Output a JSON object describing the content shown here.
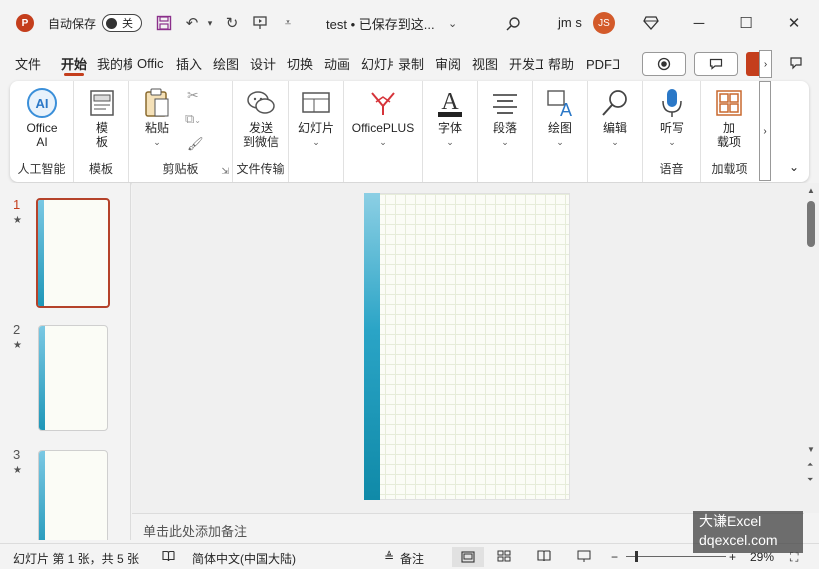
{
  "titlebar": {
    "app_logo": "P",
    "autosave_label": "自动保存",
    "autosave_state": "关",
    "doc_title": "test • 已保存到这...",
    "user_name": "jm s",
    "avatar_initials": "JS"
  },
  "tabs": [
    {
      "label": "文件"
    },
    {
      "label": "开始",
      "active": true
    },
    {
      "label": "我的模"
    },
    {
      "label": "Offic"
    },
    {
      "label": "插入"
    },
    {
      "label": "绘图"
    },
    {
      "label": "设计"
    },
    {
      "label": "切换"
    },
    {
      "label": "动画"
    },
    {
      "label": "幻灯片"
    },
    {
      "label": "录制"
    },
    {
      "label": "审阅"
    },
    {
      "label": "视图"
    },
    {
      "label": "开发工"
    },
    {
      "label": "帮助"
    },
    {
      "label": "PDF工"
    }
  ],
  "ribbon": {
    "groups": [
      {
        "label": "人工智能",
        "buttons": [
          "Office AI"
        ]
      },
      {
        "label": "模板",
        "buttons": [
          "模板"
        ]
      },
      {
        "label": "剪贴板",
        "buttons": [
          "粘贴"
        ]
      },
      {
        "label": "文件传输",
        "buttons": [
          "发送到微信"
        ]
      },
      {
        "label": "",
        "buttons": [
          "幻灯片"
        ]
      },
      {
        "label": "",
        "buttons": [
          "OfficePLUS"
        ]
      },
      {
        "label": "",
        "buttons": [
          "字体"
        ]
      },
      {
        "label": "",
        "buttons": [
          "段落"
        ]
      },
      {
        "label": "",
        "buttons": [
          "绘图"
        ]
      },
      {
        "label": "",
        "buttons": [
          "编辑"
        ]
      },
      {
        "label": "语音",
        "buttons": [
          "听写"
        ]
      },
      {
        "label": "加载项",
        "buttons": [
          "加载项"
        ]
      }
    ],
    "office_ai_line1": "Office",
    "office_ai_line2": "AI",
    "template_line1": "模",
    "template_line2": "板",
    "paste": "粘贴",
    "send_line1": "发送",
    "send_line2": "到微信",
    "slides": "幻灯片",
    "officeplus": "OfficePLUS",
    "font": "字体",
    "paragraph": "段落",
    "drawing": "绘图",
    "editing": "编辑",
    "dictate": "听写",
    "addins_line1": "加",
    "addins_line2": "载项",
    "group_ai": "人工智能",
    "group_template": "模板",
    "group_clipboard": "剪贴板",
    "group_transfer": "文件传输",
    "group_voice": "语音",
    "group_addins": "加载项"
  },
  "slides": [
    {
      "number": "1",
      "star": "★",
      "active": true
    },
    {
      "number": "2",
      "star": "★"
    },
    {
      "number": "3",
      "star": "★"
    }
  ],
  "notes_placeholder": "单击此处添加备注",
  "status": {
    "slide_info": "幻灯片 第 1 张，共 5 张",
    "language": "简体中文(中国大陆)",
    "notes": "备注",
    "zoom": "29%"
  },
  "watermark": {
    "line1": "大谦Excel",
    "line2": "dqexcel.com"
  },
  "colors": {
    "accent": "#c43e1c",
    "slide_bar": "#1f97b8"
  }
}
